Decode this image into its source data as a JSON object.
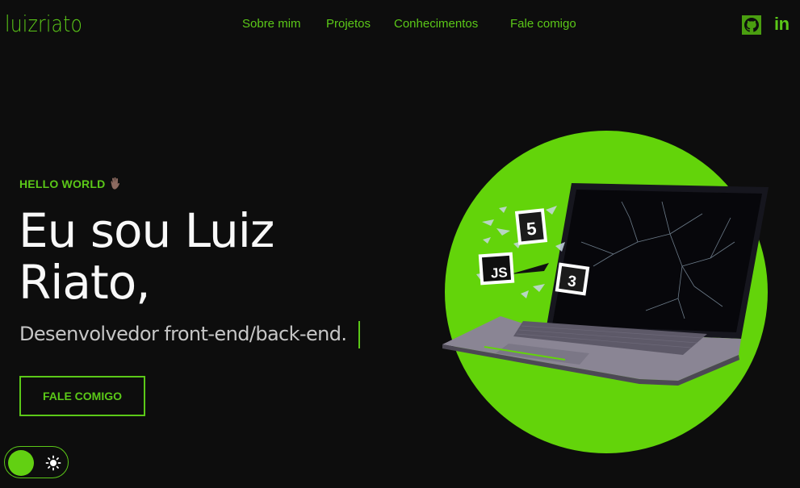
{
  "header": {
    "logo": "luizriato",
    "nav": [
      {
        "label": "Sobre mim"
      },
      {
        "label": "Projetos"
      },
      {
        "label": "Conhecimentos"
      },
      {
        "label": "Fale comigo"
      }
    ],
    "social": {
      "github_icon": "github-icon",
      "linkedin_text": "in"
    }
  },
  "hero": {
    "greeting": "HELLO WORLD",
    "wave_icon": "waving-hand-icon",
    "title": "Eu sou Luiz Riato,",
    "subtitle": "Desenvolvedor front-end/back-end.",
    "cta_label": "FALE COMIGO",
    "illustration": {
      "badges": [
        "5",
        "JS",
        "3"
      ]
    }
  },
  "theme_toggle": {
    "icon": "sun-icon"
  },
  "colors": {
    "accent": "#5bc818",
    "background": "#0d0d0d",
    "circle": "#63d40a"
  }
}
